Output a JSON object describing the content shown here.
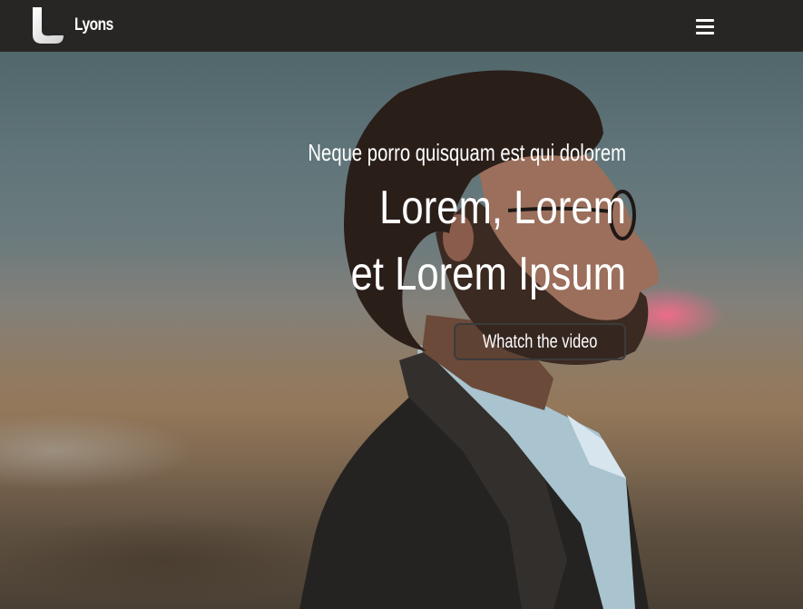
{
  "header": {
    "brand_name": "Lyons",
    "logo_icon": "lyons-l-logo-icon",
    "menu_icon": "hamburger-menu-icon",
    "background_color": "#282624"
  },
  "hero": {
    "kicker": "Neque porro quisquam est qui dolorem",
    "title_line_1": "Lorem, Lorem",
    "title_line_2": "et Lorem Ipsum",
    "cta_label": "Whatch the video",
    "background_image": "photo of bearded man in glasses and dark jacket, sunset desert backdrop",
    "text_color": "#ffffff",
    "accent_glow_color": "#ff6b8c"
  }
}
